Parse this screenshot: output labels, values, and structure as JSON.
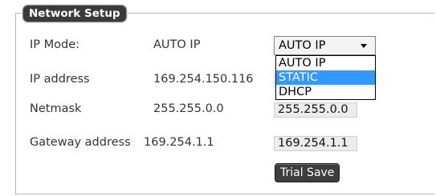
{
  "panel": {
    "title": "Network Setup"
  },
  "rows": {
    "ip_mode": {
      "label": "IP Mode:",
      "value": "AUTO IP"
    },
    "ip_address": {
      "label": "IP address",
      "value": "169.254.150.116",
      "field_visible_tail": "6"
    },
    "netmask": {
      "label": "Netmask",
      "value": "255.255.0.0",
      "field": "255.255.0.0"
    },
    "gateway": {
      "label": "Gateway address",
      "value": "169.254.1.1",
      "field": "169.254.1.1"
    }
  },
  "mode_select": {
    "selected": "AUTO IP",
    "options": [
      "AUTO IP",
      "STATIC",
      "DHCP"
    ],
    "highlighted": "STATIC"
  },
  "buttons": {
    "trial_save": "Trial Save"
  },
  "colors": {
    "highlight": "#3399ff",
    "legend_bg": "#3a3a3a",
    "button_bg": "#3d3d3d"
  }
}
